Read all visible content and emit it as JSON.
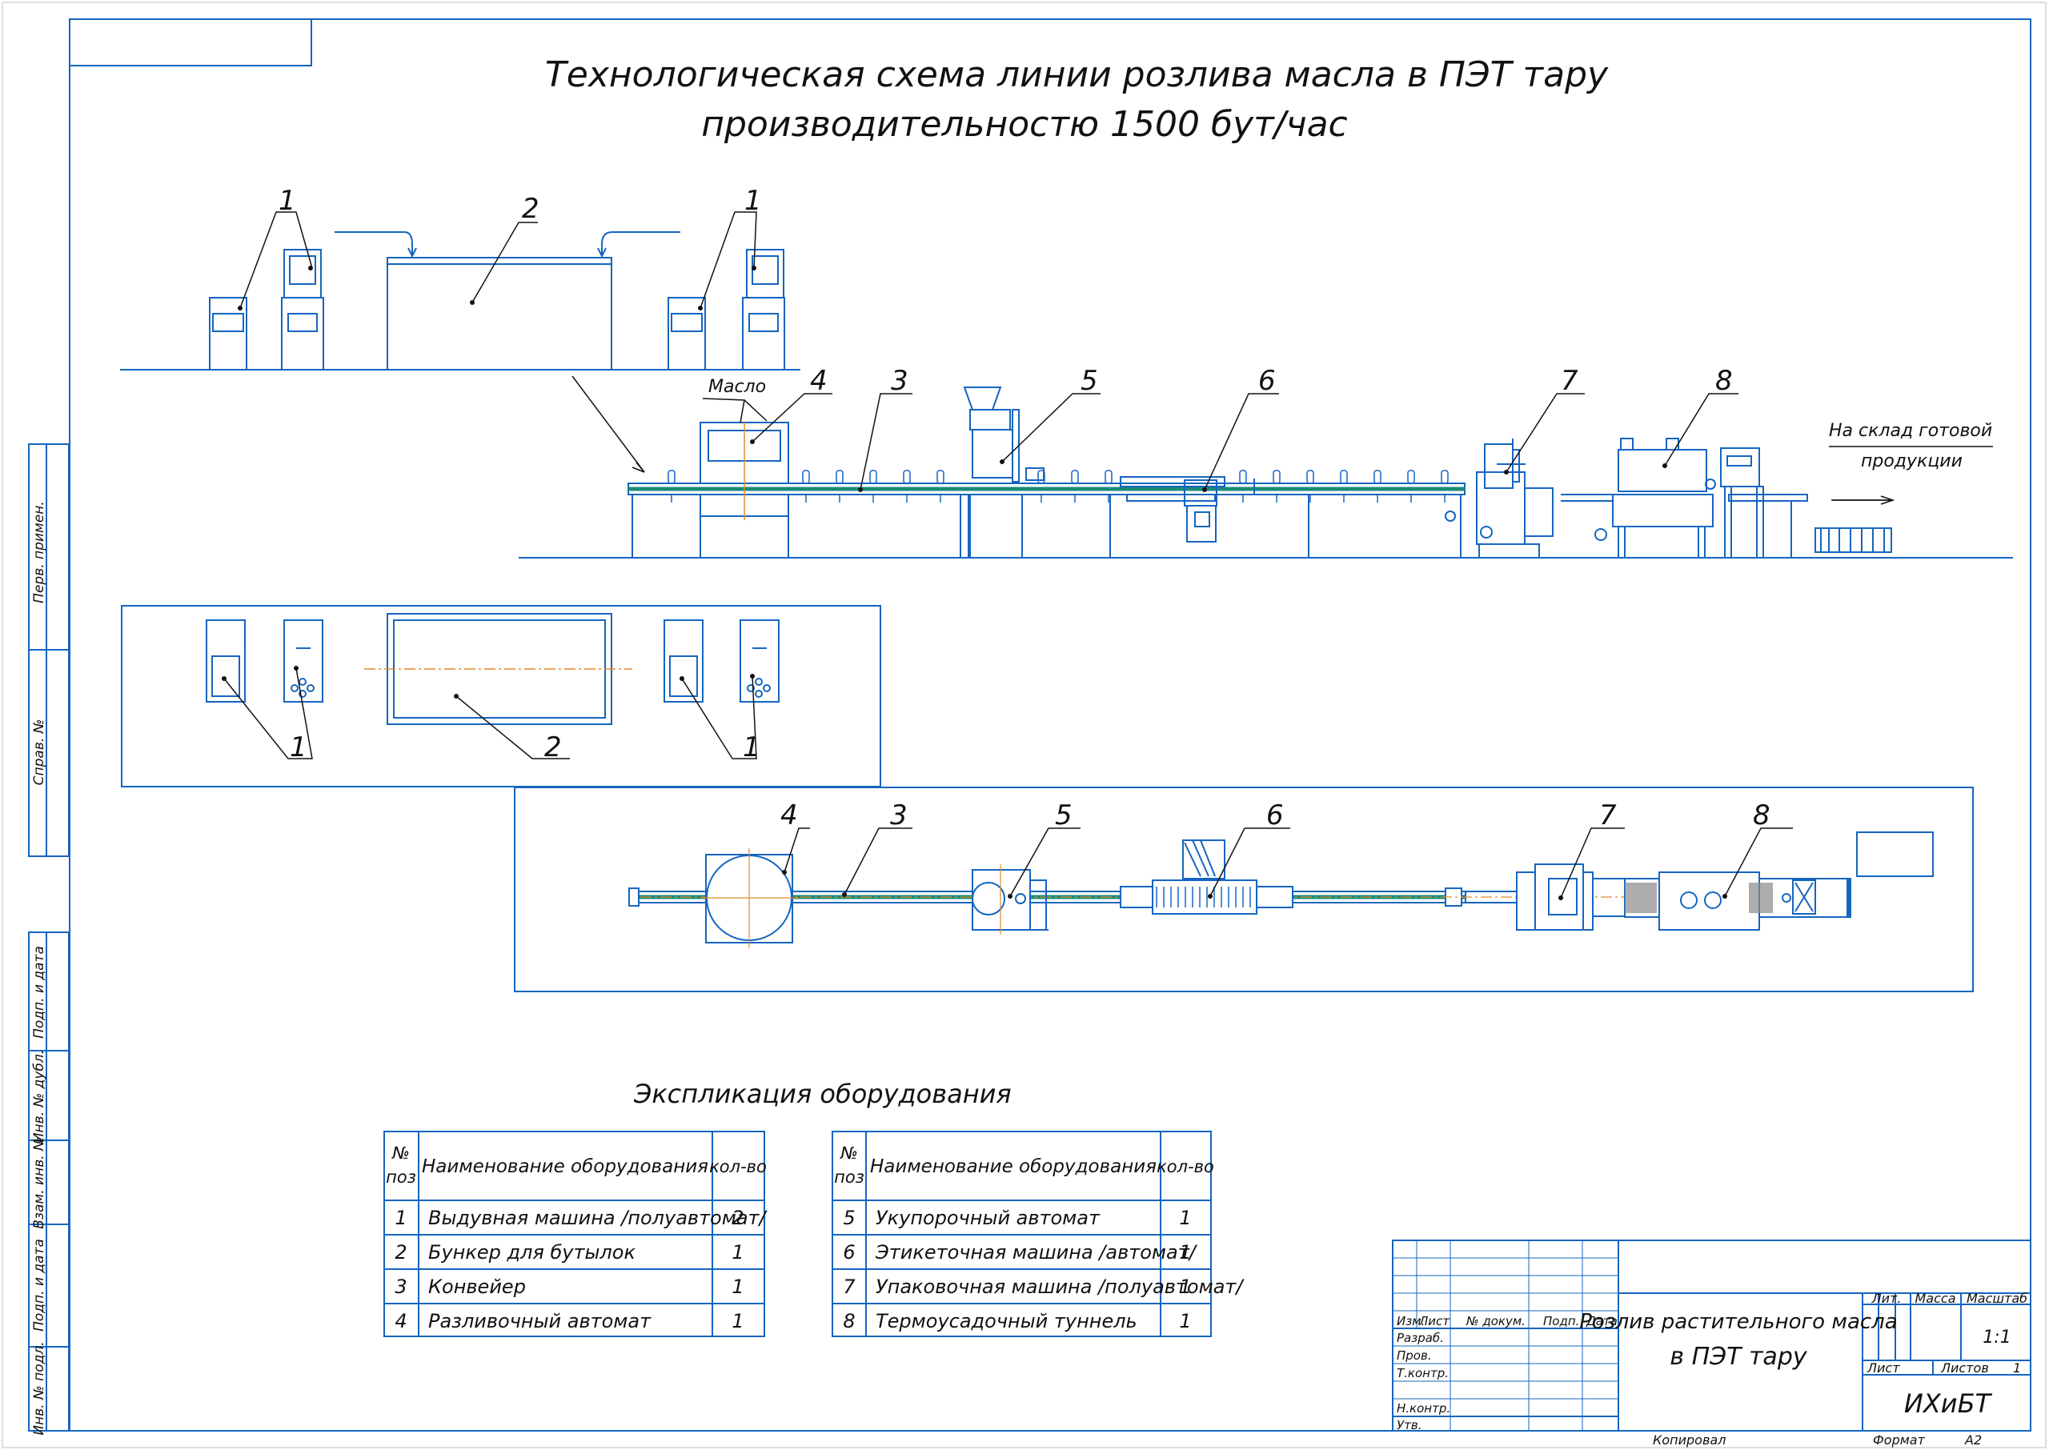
{
  "title": {
    "line1": "Технологическая схема линии розлива масла в ПЭТ тару",
    "line2": "производительностю 1500 бут/час"
  },
  "side_strip": {
    "perv_primen": "Перв. примен.",
    "sprav_no": "Справ. №",
    "podp_data_1": "Подп. и дата",
    "inv_dubl": "Инв. № дубл.",
    "vzam_inv": "Взам. инв. №",
    "podp_data_2": "Подп. и дата",
    "inv_podl": "Инв. № подл."
  },
  "elevation": {
    "oil_label": "Масло",
    "warehouse_line1": "На склад готовой",
    "warehouse_line2": "продукции",
    "pos_labels": {
      "p1": "1",
      "p2": "2",
      "p3": "3",
      "p4": "4",
      "p5": "5",
      "p6": "6",
      "p7": "7",
      "p8": "8"
    }
  },
  "explication": {
    "title": "Экспликация оборудования",
    "header": {
      "pos_line1": "№",
      "pos_line2": "поз",
      "name": "Наименование оборудования",
      "qty": "кол-во"
    },
    "table_left": [
      {
        "pos": "1",
        "name": "Выдувная машина /полуавтомат/",
        "qty": "2"
      },
      {
        "pos": "2",
        "name": "Бункер для бутылок",
        "qty": "1"
      },
      {
        "pos": "3",
        "name": "Конвейер",
        "qty": "1"
      },
      {
        "pos": "4",
        "name": "Разливочный автомат",
        "qty": "1"
      }
    ],
    "table_right": [
      {
        "pos": "5",
        "name": "Укупорочный автомат",
        "qty": "1"
      },
      {
        "pos": "6",
        "name": "Этикеточная машина /автомат/",
        "qty": "1"
      },
      {
        "pos": "7",
        "name": "Упаковочная машина /полуавтомат/",
        "qty": "1"
      },
      {
        "pos": "8",
        "name": "Термоусадочный туннель",
        "qty": "1"
      }
    ]
  },
  "title_block": {
    "izm": "Изм.",
    "list": "Лист",
    "n_dokum": "№ докум.",
    "podp": "Подп.",
    "data": "Дата",
    "razrab": "Разраб.",
    "prov": "Пров.",
    "t_kontr": "Т.контр.",
    "n_kontr": "Н.контр.",
    "utv": "Утв.",
    "doc_title_line1": "Розлив растительного масла",
    "doc_title_line2": "в ПЭТ тару",
    "lit": "Лит.",
    "massa": "Масса",
    "masshtab": "Масштаб",
    "scale_value": "1:1",
    "list_label": "Лист",
    "listov_label": "Листов",
    "listov_value": "1",
    "org": "ИХиБТ",
    "kopiroval": "Копировал",
    "format_label": "Формат",
    "format_value": "А2"
  },
  "colors": {
    "line": "#1565c0",
    "conveyor": "#1b8a7a",
    "axis": "#e08a2e",
    "text": "#111111",
    "hatch": "#7a7a7a"
  }
}
